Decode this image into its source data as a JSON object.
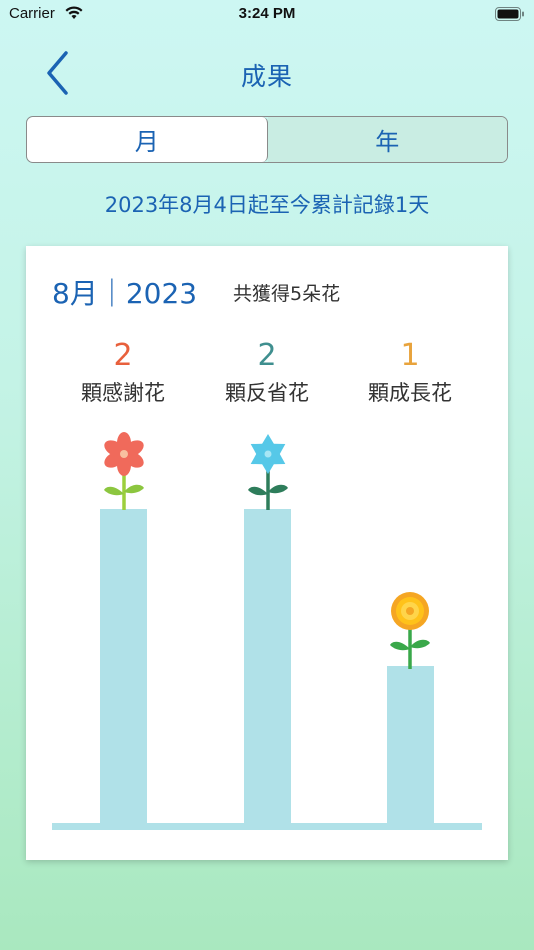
{
  "status_bar": {
    "carrier": "Carrier",
    "time": "3:24 PM"
  },
  "nav": {
    "title": "成果"
  },
  "segments": {
    "month": "月",
    "year": "年",
    "selected": "month"
  },
  "record_summary": "2023年8月4日起至今累計記錄1天",
  "card": {
    "period": "8月｜2023",
    "total": "共獲得5朵花",
    "categories": [
      {
        "count": "2",
        "label": "顆感謝花",
        "color": "#e8603c",
        "flower": "red-flower-icon"
      },
      {
        "count": "2",
        "label": "顆反省花",
        "color": "#3f8f8f",
        "flower": "blue-flower-icon"
      },
      {
        "count": "1",
        "label": "顆成長花",
        "color": "#e8a33c",
        "flower": "yellow-flower-icon"
      }
    ]
  },
  "colors": {
    "accent": "#1b63b3",
    "bar": "#b0e1e8"
  }
}
